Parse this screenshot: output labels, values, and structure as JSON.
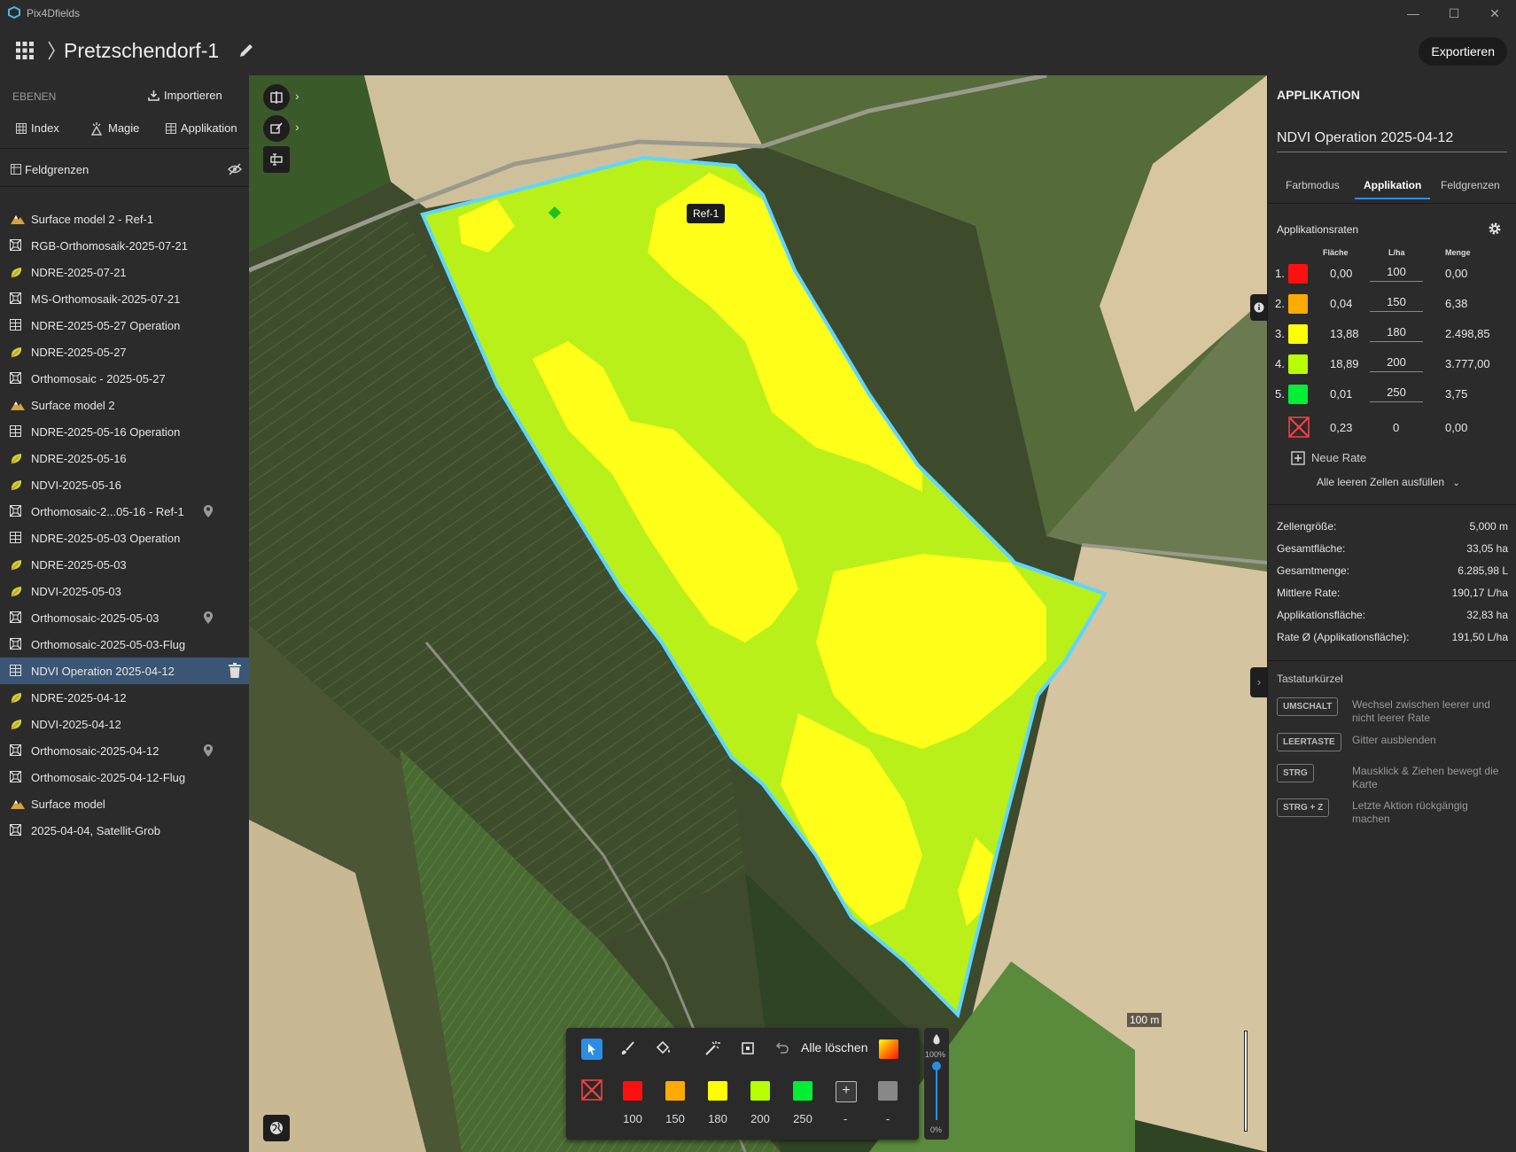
{
  "app": {
    "title": "Pix4Dfields",
    "minimize": "—",
    "maximize": "☐",
    "close": "✕"
  },
  "header": {
    "project_title": "Pretzschendorf-1",
    "export_label": "Exportieren"
  },
  "left_panel": {
    "section_label": "EBENEN",
    "import_label": "Importieren",
    "tabs": [
      {
        "label": "Index",
        "icon": "grid-icon"
      },
      {
        "label": "Magie",
        "icon": "magic-icon"
      },
      {
        "label": "Applikation",
        "icon": "table-icon"
      }
    ],
    "field_boundaries_label": "Feldgrenzen",
    "layers": [
      {
        "label": "Surface model 2 - Ref-1",
        "icon": "mountain-icon",
        "pin": false
      },
      {
        "label": "RGB-Orthomosaik-2025-07-21",
        "icon": "mosaic-icon",
        "pin": false
      },
      {
        "label": "NDRE-2025-07-21",
        "icon": "leaf-icon",
        "pin": false
      },
      {
        "label": "MS-Orthomosaik-2025-07-21",
        "icon": "mosaic-icon",
        "pin": false
      },
      {
        "label": "NDRE-2025-05-27 Operation",
        "icon": "table-icon",
        "pin": false
      },
      {
        "label": "NDRE-2025-05-27",
        "icon": "leaf-icon",
        "pin": false
      },
      {
        "label": "Orthomosaic - 2025-05-27",
        "icon": "mosaic-icon",
        "pin": false
      },
      {
        "label": "Surface model 2",
        "icon": "mountain-icon",
        "pin": false
      },
      {
        "label": "NDRE-2025-05-16 Operation",
        "icon": "table-icon",
        "pin": false
      },
      {
        "label": "NDRE-2025-05-16",
        "icon": "leaf-icon",
        "pin": false
      },
      {
        "label": "NDVI-2025-05-16",
        "icon": "leaf-icon",
        "pin": false
      },
      {
        "label": "Orthomosaic-2...05-16 - Ref-1",
        "icon": "mosaic-icon",
        "pin": true
      },
      {
        "label": "NDRE-2025-05-03 Operation",
        "icon": "table-icon",
        "pin": false
      },
      {
        "label": "NDRE-2025-05-03",
        "icon": "leaf-icon",
        "pin": false
      },
      {
        "label": "NDVI-2025-05-03",
        "icon": "leaf-icon",
        "pin": false
      },
      {
        "label": "Orthomosaic-2025-05-03",
        "icon": "mosaic-icon",
        "pin": true
      },
      {
        "label": "Orthomosaic-2025-05-03-Flug",
        "icon": "mosaic-icon",
        "pin": false
      },
      {
        "label": "NDVI Operation 2025-04-12",
        "icon": "table-icon",
        "pin": false,
        "selected": true
      },
      {
        "label": "NDRE-2025-04-12",
        "icon": "leaf-icon",
        "pin": false
      },
      {
        "label": "NDVI-2025-04-12",
        "icon": "leaf-icon",
        "pin": false
      },
      {
        "label": "Orthomosaic-2025-04-12",
        "icon": "mosaic-icon",
        "pin": true
      },
      {
        "label": "Orthomosaic-2025-04-12-Flug",
        "icon": "mosaic-icon",
        "pin": false
      },
      {
        "label": "Surface model",
        "icon": "mountain-icon",
        "pin": false
      },
      {
        "label": "2025-04-04, Satellit-Grob",
        "icon": "mosaic-icon",
        "pin": false
      }
    ]
  },
  "map": {
    "field_label": "Ref-1",
    "scale_label": "100 m",
    "toolbar": {
      "clear_all_label": "Alle löschen",
      "opacity_top": "100%",
      "opacity_bottom": "0%",
      "opacity_value": 100,
      "swatches": [
        {
          "color": "#ff1010",
          "label": "100"
        },
        {
          "color": "#ffaa00",
          "label": "150"
        },
        {
          "color": "#ffff00",
          "label": "180"
        },
        {
          "color": "#b8ff00",
          "label": "200"
        },
        {
          "color": "#00ee33",
          "label": "250"
        },
        {
          "color": "#555555",
          "label": "-"
        },
        {
          "color": "#888888",
          "label": "-"
        }
      ]
    }
  },
  "right_panel": {
    "section_title": "APPLIKATION",
    "operation_name": "NDVI Operation 2025-04-12",
    "tabs": [
      "Farbmodus",
      "Applikation",
      "Feldgrenzen"
    ],
    "active_tab": "Applikation",
    "rates_title": "Applikationsraten",
    "columns": {
      "area": "Fläche",
      "rate": "L/ha",
      "amount": "Menge"
    },
    "rates": [
      {
        "index": "1.",
        "color": "#ff1010",
        "area": "0,00",
        "rate": "100",
        "amount": "0,00"
      },
      {
        "index": "2.",
        "color": "#ffaa00",
        "area": "0,04",
        "rate": "150",
        "amount": "6,38"
      },
      {
        "index": "3.",
        "color": "#ffff00",
        "area": "13,88",
        "rate": "180",
        "amount": "2.498,85"
      },
      {
        "index": "4.",
        "color": "#b8ff00",
        "area": "18,89",
        "rate": "200",
        "amount": "3.777,00"
      },
      {
        "index": "5.",
        "color": "#00ee33",
        "area": "0,01",
        "rate": "250",
        "amount": "3,75"
      }
    ],
    "empty_rate": {
      "area": "0,23",
      "rate": "0",
      "amount": "0,00"
    },
    "new_rate_label": "Neue Rate",
    "fill_empty_label": "Alle leeren Zellen ausfüllen",
    "stats": [
      {
        "label": "Zellengröße:",
        "value": "5,000 m"
      },
      {
        "label": "Gesamtfläche:",
        "value": "33,05 ha"
      },
      {
        "label": "Gesamtmenge:",
        "value": "6.285,98 L"
      },
      {
        "label": "Mittlere Rate:",
        "value": "190,17 L/ha"
      },
      {
        "label": "Applikationsfläche:",
        "value": "32,83 ha"
      },
      {
        "label": "Rate Ø (Applikationsfläche):",
        "value": "191,50 L/ha"
      }
    ],
    "shortcuts_title": "Tastaturkürzel",
    "shortcuts": [
      {
        "key": "UMSCHALT",
        "desc": "Wechsel zwischen leerer und nicht leerer Rate"
      },
      {
        "key": "LEERTASTE",
        "desc": "Gitter ausblenden"
      },
      {
        "key": "STRG",
        "desc": "Mausklick & Ziehen bewegt die Karte"
      },
      {
        "key": "STRG + Z",
        "desc": "Letzte Aktion rückgängig machen"
      }
    ]
  }
}
